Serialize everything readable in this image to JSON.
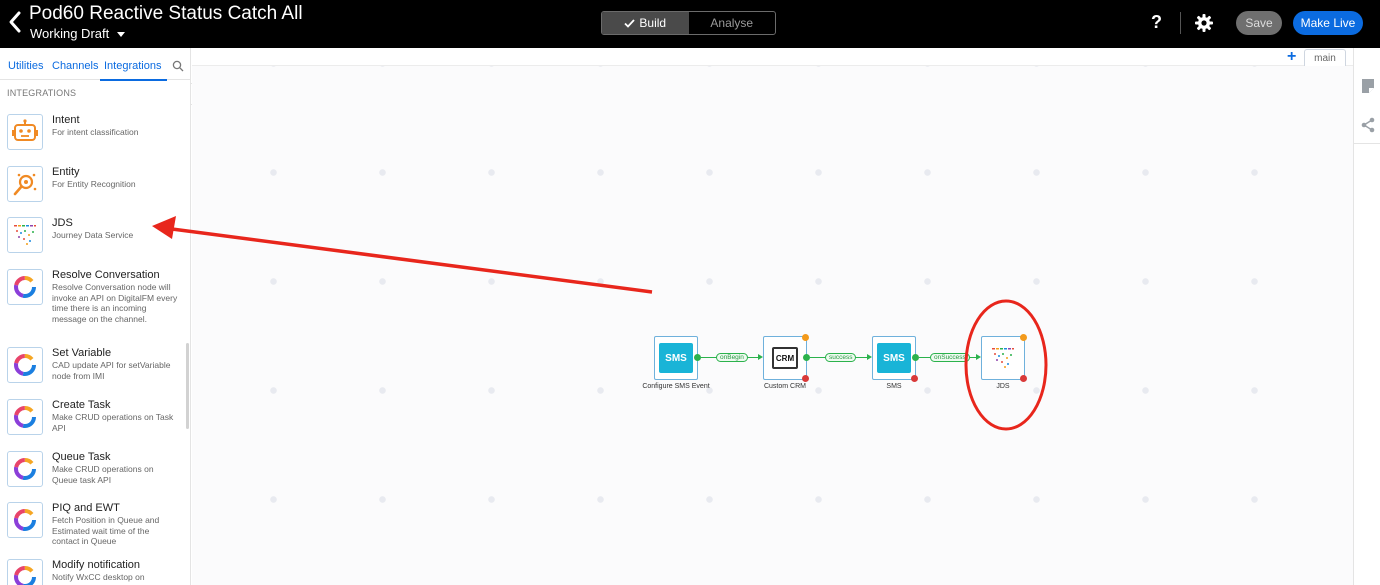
{
  "header": {
    "title": "Pod60 Reactive Status Catch All",
    "draft_label": "Working Draft",
    "modes": [
      {
        "label": "Build",
        "active": true
      },
      {
        "label": "Analyse",
        "active": false
      }
    ],
    "help_label": "?",
    "save_label": "Save",
    "make_live_label": "Make Live"
  },
  "sidebar": {
    "tabs": [
      {
        "label": "Utilities",
        "active": false
      },
      {
        "label": "Channels",
        "active": false
      },
      {
        "label": "Integrations",
        "active": true
      }
    ],
    "section_label": "INTEGRATIONS",
    "items": [
      {
        "name": "Intent",
        "desc": "For intent classification",
        "icon": "robot-icon"
      },
      {
        "name": "Entity",
        "desc": "For Entity Recognition",
        "icon": "entity-icon"
      },
      {
        "name": "JDS",
        "desc": "Journey Data Service",
        "icon": "jds-icon"
      },
      {
        "name": "Resolve Conversation",
        "desc": "Resolve Conversation node will invoke an API on DigitalFM every time there is an incoming message on the channel.",
        "icon": "webex-connect-icon"
      },
      {
        "name": "Set Variable",
        "desc": "CAD update API for setVariable node from IMI",
        "icon": "webex-connect-icon"
      },
      {
        "name": "Create Task",
        "desc": "Make CRUD operations on Task API",
        "icon": "webex-connect-icon"
      },
      {
        "name": "Queue Task",
        "desc": "Make CRUD operations on Queue task API",
        "icon": "webex-connect-icon"
      },
      {
        "name": "PIQ and EWT",
        "desc": "Fetch Position in Queue and Estimated wait time of the contact in Queue",
        "icon": "webex-connect-icon"
      },
      {
        "name": "Modify notification",
        "desc": "Notify WxCC desktop on",
        "icon": "webex-connect-icon"
      }
    ]
  },
  "canvas": {
    "tab_label": "main",
    "nodes": [
      {
        "id": "configure-sms-event",
        "label": "Configure SMS Event",
        "tile": "SMS"
      },
      {
        "id": "custom-crm",
        "label": "Custom CRM",
        "tile": "CRM"
      },
      {
        "id": "sms",
        "label": "SMS",
        "tile": "SMS"
      },
      {
        "id": "jds",
        "label": "JDS",
        "tile": ""
      }
    ],
    "edges": [
      {
        "label": "onBegin"
      },
      {
        "label": "success"
      },
      {
        "label": "onSuccess"
      }
    ]
  },
  "colors": {
    "accent": "#0b6be0",
    "annotation": "#e8261c",
    "success": "#2bb24c",
    "error": "#d93a3a",
    "warning": "#f39a1b",
    "sms_tile": "#19b4d7"
  }
}
